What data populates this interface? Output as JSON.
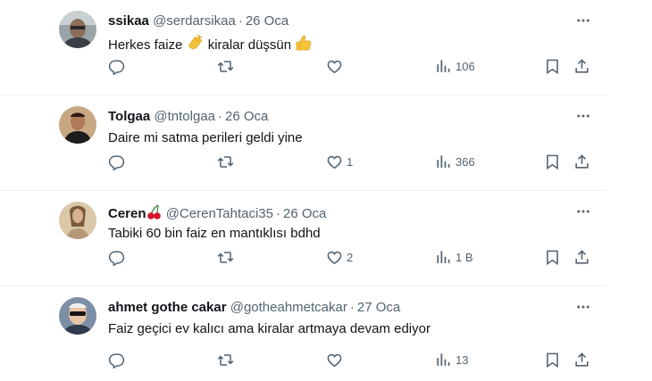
{
  "tweets": [
    {
      "name": "ssikaa",
      "handle": "@serdarsikaa",
      "separator": "·",
      "date": "26 Oca",
      "text_before": "Herkes faize",
      "text_middle": "kiralar düşsün",
      "emoji_1": "clapping-hands",
      "emoji_2": "thumbs-up",
      "likes": "",
      "views": "106"
    },
    {
      "name": "Tolgaa",
      "handle": "@tntolgaa",
      "separator": "·",
      "date": "26 Oca",
      "text": "Daire mi satma perileri geldi yine",
      "likes": "1",
      "views": "366"
    },
    {
      "name": "Ceren",
      "name_emoji": "cherries",
      "handle": "@CerenTahtaci35",
      "separator": "·",
      "date": "26 Oca",
      "text": "Tabiki 60 bin faiz en mantıklısı bdhd",
      "likes": "2",
      "views": "1 B"
    },
    {
      "name": "ahmet gothe cakar",
      "handle": "@gotheahmetcakar",
      "separator": "·",
      "date": "27 Oca",
      "text": "Faiz geçici ev kalıcı ama kiralar artmaya devam ediyor",
      "likes": "",
      "views": "13"
    }
  ],
  "colors": {
    "text": "#0f1419",
    "secondary": "#536471",
    "divider": "#eff3f4"
  }
}
